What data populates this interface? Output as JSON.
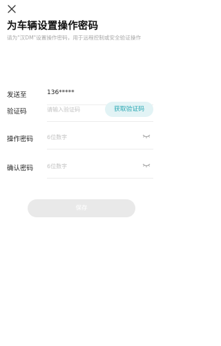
{
  "header": {
    "close_icon": "close-icon",
    "title": "为车辆设置操作密码",
    "description": "请为\"汉DM\"设置操作密码，用于远程控制或安全验证操作"
  },
  "form": {
    "send_to": {
      "label": "发送至",
      "value": "136*****"
    },
    "code": {
      "label": "验证码",
      "placeholder": "请输入验证码",
      "button_label": "获取验证码"
    },
    "password": {
      "label": "操作密码",
      "placeholder": "6位数字",
      "eye_icon": "eye-closed-icon"
    },
    "confirm": {
      "label": "确认密码",
      "placeholder": "6位数字",
      "eye_icon": "eye-closed-icon"
    }
  },
  "actions": {
    "save_label": "保存"
  },
  "colors": {
    "accent": "#2aa8b4",
    "accent_bg": "#e2f3f5",
    "disabled_button": "#e9e9e9",
    "placeholder": "#c2c2c2",
    "description": "#a8a8a8",
    "divider": "#ececec"
  }
}
